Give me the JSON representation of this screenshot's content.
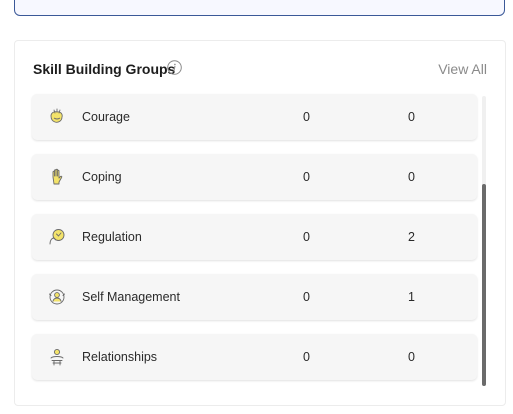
{
  "panel": {
    "title": "Skill Building Groups",
    "view_all_label": "View All"
  },
  "groups": [
    {
      "label": "Courage",
      "value_1": "0",
      "value_2": "0",
      "icon": "courage-icon"
    },
    {
      "label": "Coping",
      "value_1": "0",
      "value_2": "0",
      "icon": "coping-icon"
    },
    {
      "label": "Regulation",
      "value_1": "0",
      "value_2": "2",
      "icon": "regulation-icon"
    },
    {
      "label": "Self Management",
      "value_1": "0",
      "value_2": "1",
      "icon": "self-management-icon"
    },
    {
      "label": "Relationships",
      "value_1": "0",
      "value_2": "0",
      "icon": "relationships-icon"
    }
  ],
  "colors": {
    "icon_fill": "#f3e36a",
    "icon_stroke": "#6a6a6a",
    "top_box_border": "#3b5998"
  }
}
